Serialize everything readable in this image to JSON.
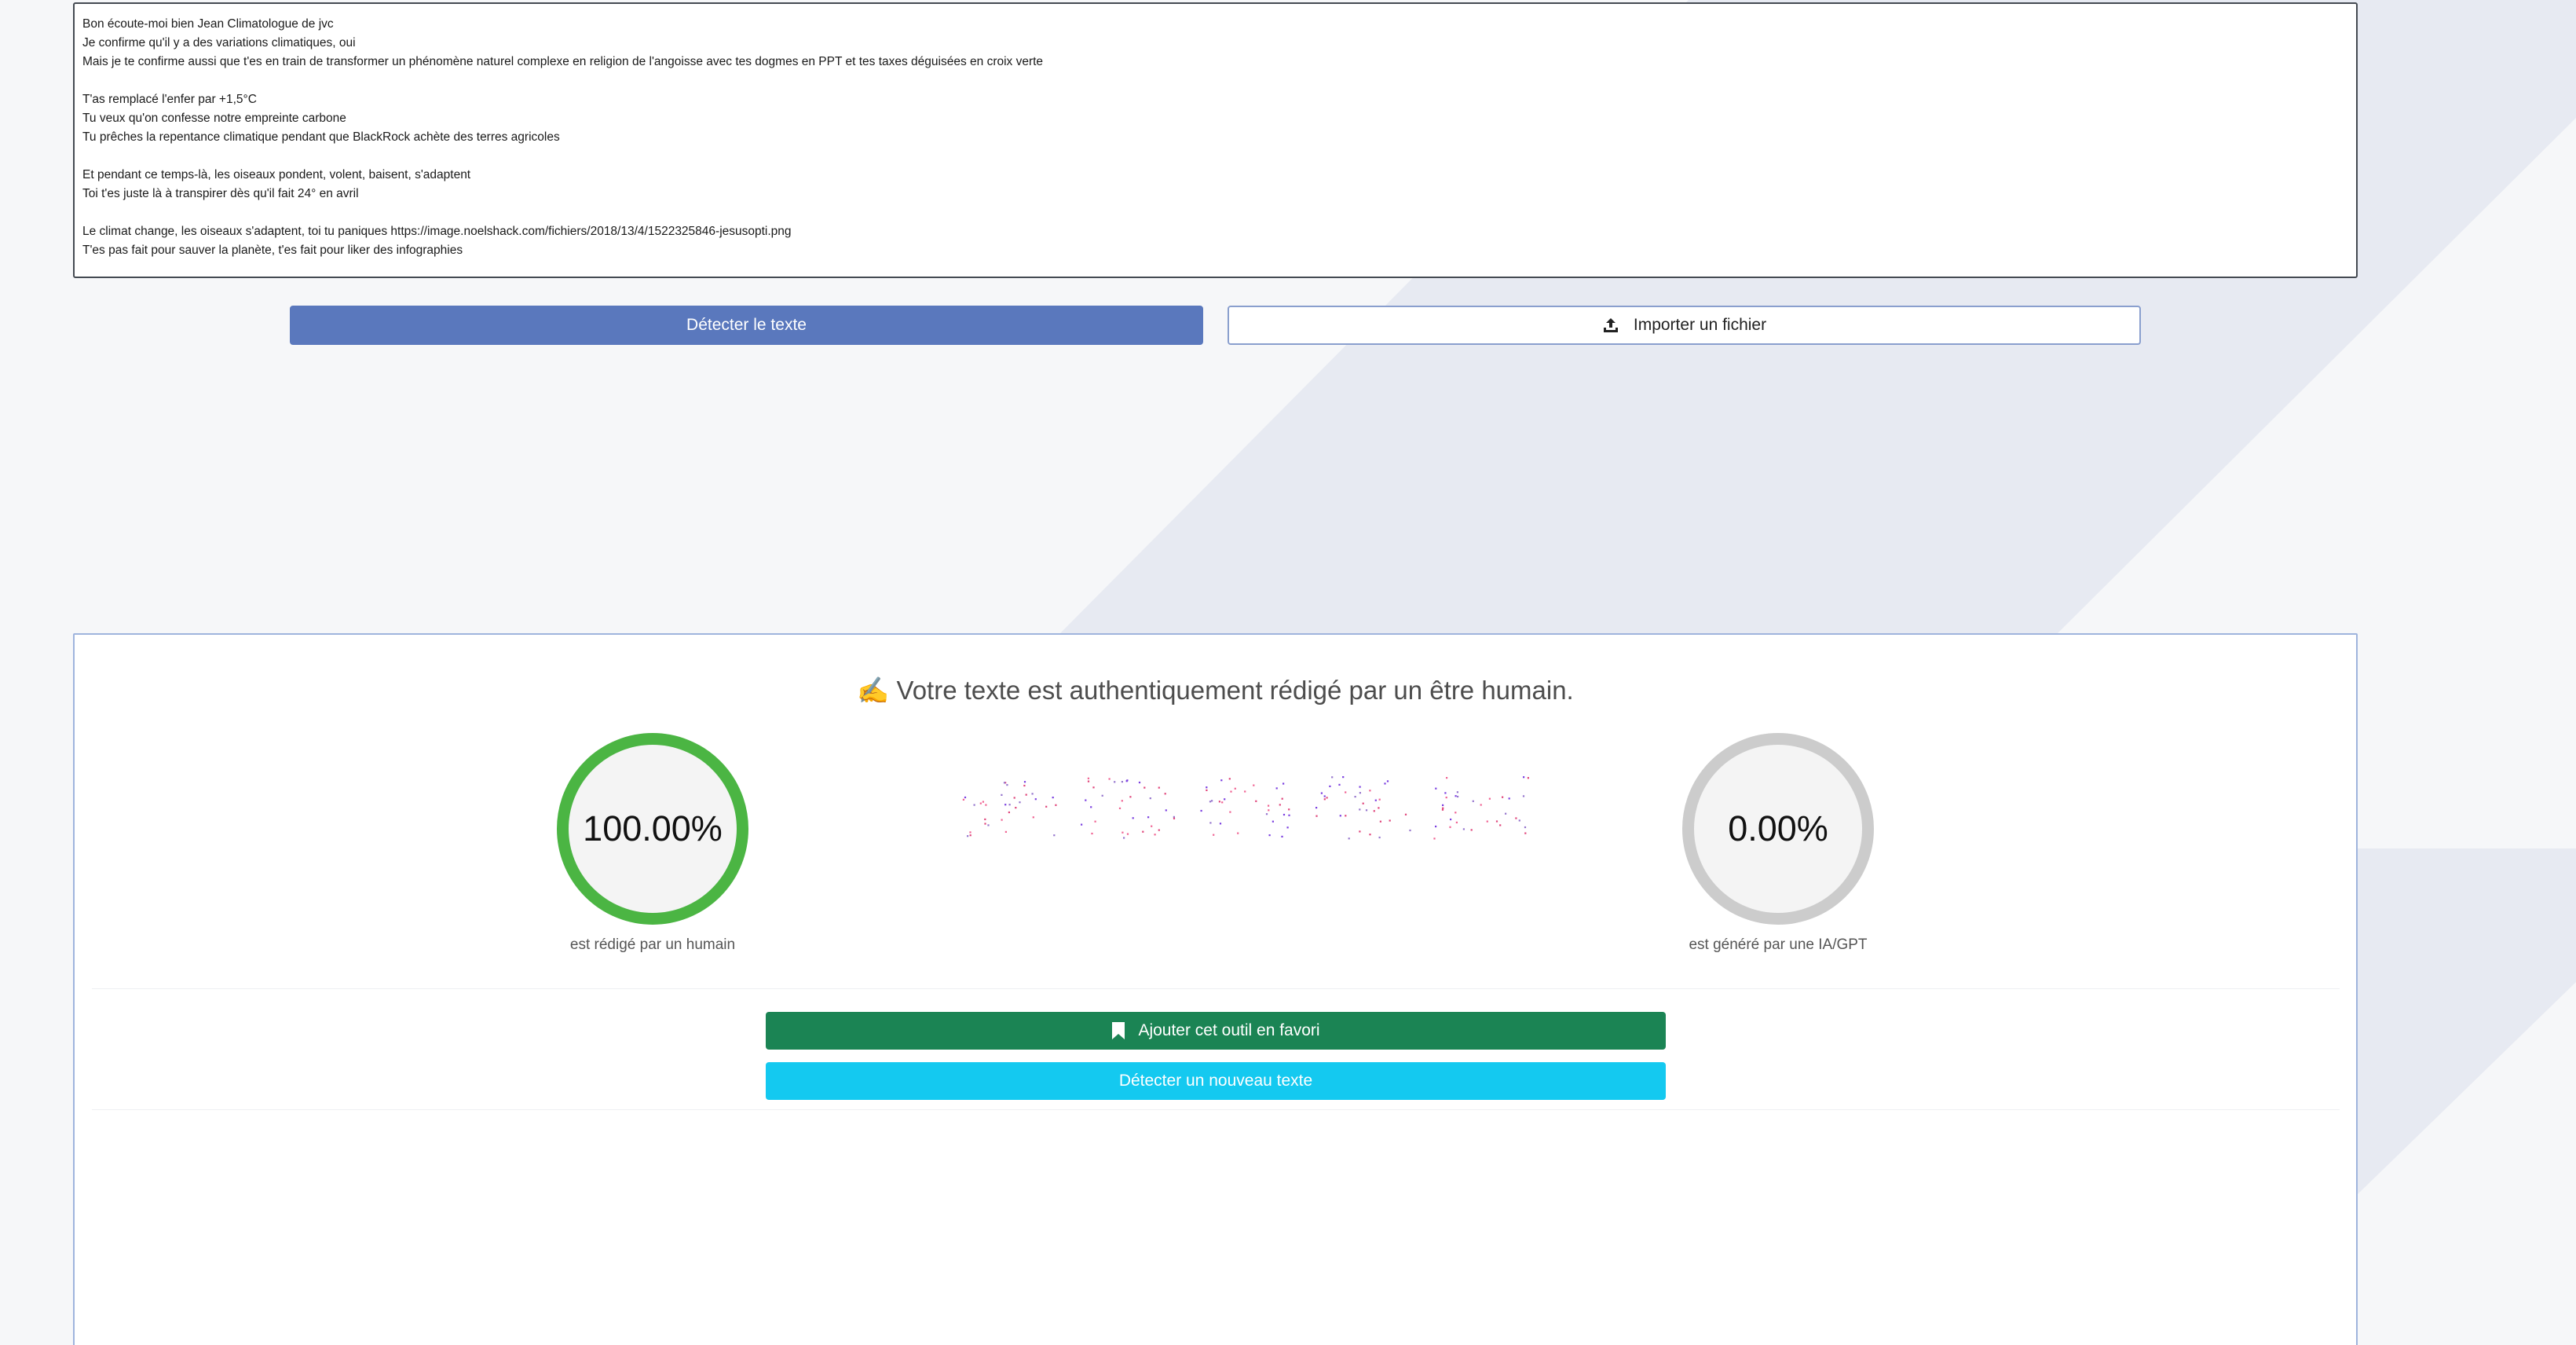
{
  "editor": {
    "lines": [
      "Bon écoute-moi bien Jean Climatologue de jvc",
      "Je confirme qu'il y a des variations climatiques, oui",
      "Mais je te confirme aussi que t'es en train de transformer un phénomène naturel complexe en religion de l'angoisse avec tes dogmes en PPT et tes taxes déguisées en croix verte",
      "",
      "T'as remplacé l'enfer par +1,5°C",
      "Tu veux qu'on confesse notre empreinte carbone",
      "Tu prêches la repentance climatique pendant que BlackRock achète des terres agricoles",
      "",
      "Et pendant ce temps-là, les oiseaux pondent, volent, baisent, s'adaptent",
      "Toi t'es juste là à transpirer dès qu'il fait 24° en avril",
      "",
      "Le climat change, les oiseaux s'adaptent, toi tu paniques https://image.noelshack.com/fichiers/2018/13/4/1522325846-jesusopti.png",
      "T'es pas fait pour sauver la planète, t'es fait pour liker des infographies"
    ]
  },
  "actions": {
    "detect_label": "Détecter le texte",
    "import_label": "Importer un fichier",
    "import_icon": "upload-icon"
  },
  "result": {
    "title": "✍️ Votre texte est authentiquement rédigé par un être humain.",
    "human": {
      "value": "100.00%",
      "caption": "est rédigé par un humain",
      "color": "#4bb543"
    },
    "ai": {
      "value": "0.00%",
      "caption": "est généré par une IA/GPT",
      "color": "#cccccc"
    },
    "favorite_label": "Ajouter cet outil en favori",
    "favorite_icon": "bookmark-icon",
    "new_label": "Détecter un nouveau texte"
  },
  "colors": {
    "primary": "#5a78bd",
    "success": "#1b8454",
    "info": "#14c9f0"
  }
}
